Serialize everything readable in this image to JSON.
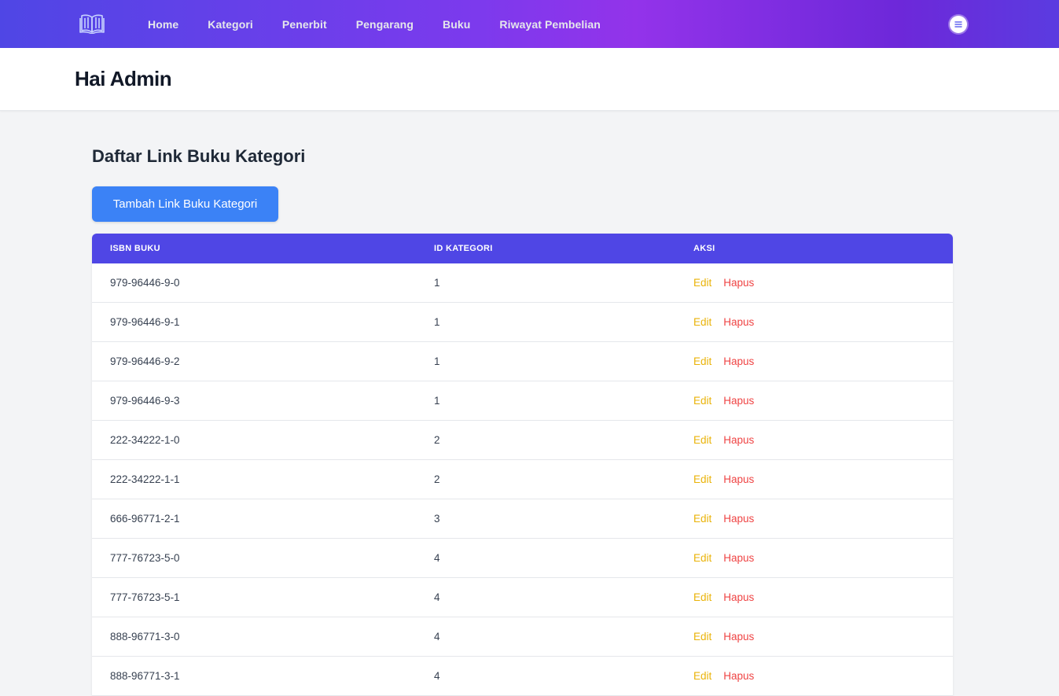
{
  "nav": {
    "logo_icon": "open-book-icon",
    "items": [
      "Home",
      "Kategori",
      "Penerbit",
      "Pengarang",
      "Buku",
      "Riwayat Pembelian"
    ],
    "menu_icon": "hamburger-menu-icon"
  },
  "header": {
    "greeting": "Hai Admin"
  },
  "main": {
    "title": "Daftar Link Buku Kategori",
    "add_button": "Tambah Link Buku Kategori",
    "table": {
      "columns": [
        "ISBN BUKU",
        "ID KATEGORI",
        "AKSI"
      ],
      "action_labels": {
        "edit": "Edit",
        "delete": "Hapus"
      },
      "rows": [
        {
          "isbn": "979-96446-9-0",
          "id_kategori": "1"
        },
        {
          "isbn": "979-96446-9-1",
          "id_kategori": "1"
        },
        {
          "isbn": "979-96446-9-2",
          "id_kategori": "1"
        },
        {
          "isbn": "979-96446-9-3",
          "id_kategori": "1"
        },
        {
          "isbn": "222-34222-1-0",
          "id_kategori": "2"
        },
        {
          "isbn": "222-34222-1-1",
          "id_kategori": "2"
        },
        {
          "isbn": "666-96771-2-1",
          "id_kategori": "3"
        },
        {
          "isbn": "777-76723-5-0",
          "id_kategori": "4"
        },
        {
          "isbn": "777-76723-5-1",
          "id_kategori": "4"
        },
        {
          "isbn": "888-96771-3-0",
          "id_kategori": "4"
        },
        {
          "isbn": "888-96771-3-1",
          "id_kategori": "4"
        }
      ]
    }
  },
  "colors": {
    "nav_gradient_start": "#4f46e5",
    "nav_gradient_mid": "#9333ea",
    "table_header": "#4f46e5",
    "primary_button": "#3b82f6",
    "edit": "#eab308",
    "delete": "#ef4444"
  }
}
